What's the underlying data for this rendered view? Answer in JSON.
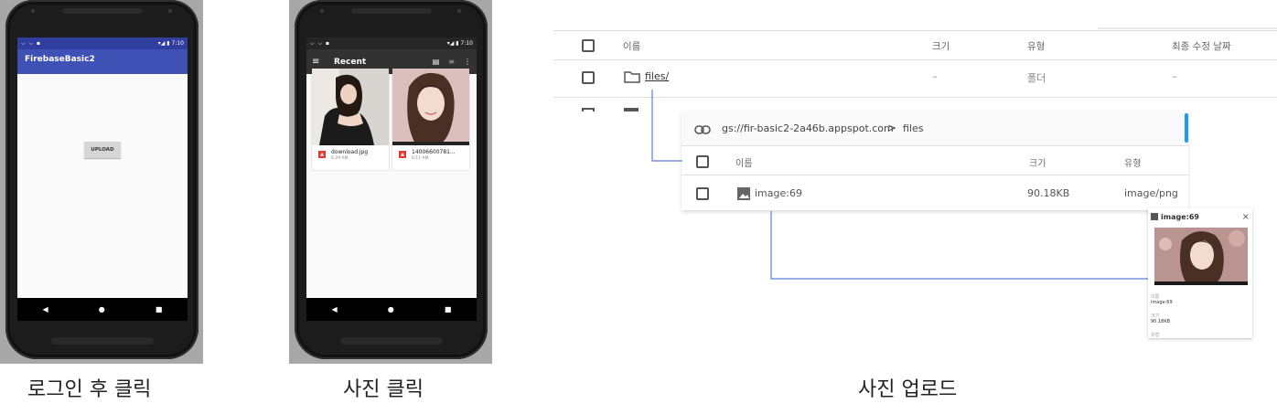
{
  "colors": {
    "android_primary": "#3f51b5",
    "android_primary_dark": "#303f9f",
    "picker_toolbar": "#323232",
    "connector_line": "#5b7fd8",
    "scrollbar_accent": "#2196f3",
    "image_badge": "#e53935"
  },
  "phone1": {
    "status_time": "7:10",
    "app_title": "FirebaseBasic2",
    "upload_button": "UPLOAD",
    "nav_icons": [
      "back-triangle",
      "home-circle",
      "recents-square"
    ]
  },
  "phone2": {
    "status_time": "7:10",
    "toolbar_title": "Recent",
    "files": [
      {
        "name": "download.jpg",
        "time": "6:29 AM"
      },
      {
        "name": "14006600781...",
        "time": "6:11 AM"
      }
    ]
  },
  "storage_root": {
    "columns": {
      "name": "이름",
      "size": "크기",
      "type": "유형",
      "modified": "최종 수정 날짜"
    },
    "rows": [
      {
        "name": "files/",
        "size": "–",
        "type": "폴더",
        "modified": "–"
      }
    ]
  },
  "storage_files": {
    "path": "gs://fir-basic2-2a46b.appspot.com",
    "path_separator": ">",
    "folder": "files",
    "columns": {
      "name": "이름",
      "size": "크기",
      "type": "유형"
    },
    "rows": [
      {
        "name": "image:69",
        "size": "90.18KB",
        "type": "image/png"
      }
    ]
  },
  "preview": {
    "title": "image:69",
    "close": "×",
    "name_label": "이름",
    "name_value": "image:69",
    "size_label": "크기",
    "size_value": "90.18KB",
    "type_label": "유형"
  },
  "captions": {
    "login": "로그인 후 클릭",
    "photo_click": "사진 클릭",
    "photo_upload": "사진 업로드"
  }
}
